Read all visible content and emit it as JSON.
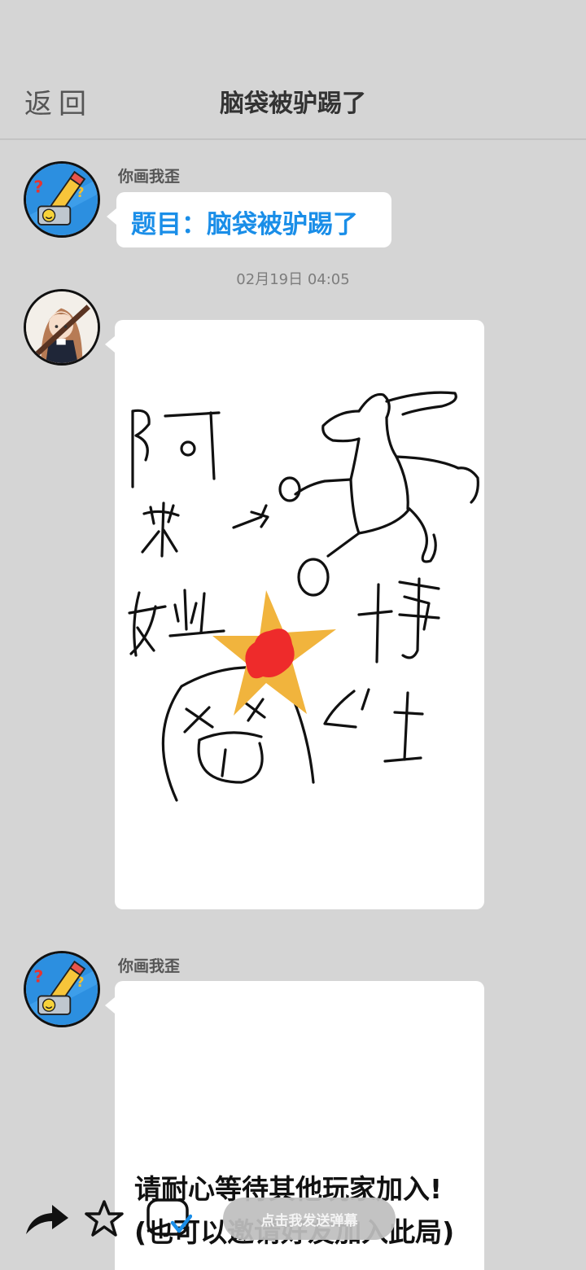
{
  "header": {
    "back_label": "返回",
    "title": "脑袋被驴踢了"
  },
  "messages": [
    {
      "sender": "你画我歪",
      "topic": "题目：脑袋被驴踢了",
      "avatar_icon": "pencil-question-avatar-icon"
    },
    {
      "timestamp": "02月19日  04:05",
      "avatar_icon": "anime-girl-avatar",
      "drawing_labels": [
        "阿米娅",
        "博士"
      ]
    },
    {
      "sender": "你画我歪",
      "avatar_icon": "pencil-question-avatar-icon"
    }
  ],
  "waiting": {
    "line1": "请耐心等待其他玩家加入!",
    "line2": "(也可以邀请好友加入此局)"
  },
  "bottom_bar": {
    "share_icon": "share-arrow-icon",
    "favorite_icon": "star-icon",
    "invite_icon": "invite-icon",
    "danmaku_label": "点击我发送弹幕"
  },
  "colors": {
    "background": "#d5d5d5",
    "accent_blue": "#1a8ee8",
    "star_yellow": "#f1b43d",
    "blood_red": "#ee2b2b"
  }
}
